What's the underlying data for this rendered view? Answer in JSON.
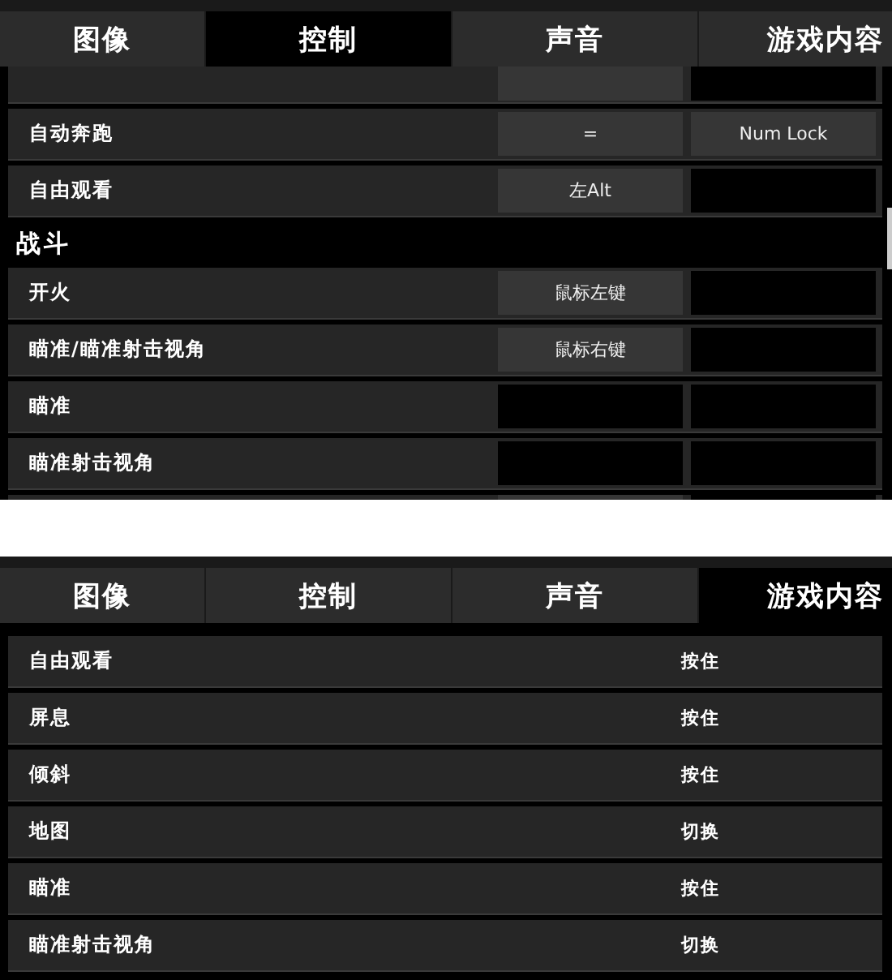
{
  "controls_screen": {
    "tabs": [
      {
        "label": "图像",
        "selected": false
      },
      {
        "label": "控制",
        "selected": true
      },
      {
        "label": "声音",
        "selected": false
      },
      {
        "label": "游戏内容",
        "selected": false
      }
    ],
    "bindings": [
      {
        "kind": "cut",
        "primary_bound": true,
        "secondary_bound": false
      },
      {
        "kind": "row",
        "action": "自动奔跑",
        "primary": "=",
        "secondary": "Num Lock"
      },
      {
        "kind": "row",
        "action": "自由观看",
        "primary": "左Alt"
      },
      {
        "kind": "heading",
        "title": "战斗"
      },
      {
        "kind": "row",
        "action": "开火",
        "primary": "鼠标左键"
      },
      {
        "kind": "row",
        "action": "瞄准/瞄准射击视角",
        "primary": "鼠标右键"
      },
      {
        "kind": "row",
        "action": "瞄准"
      },
      {
        "kind": "row",
        "action": "瞄准射击视角"
      },
      {
        "kind": "cut",
        "primary_bound": true,
        "secondary_bound": false
      }
    ]
  },
  "gameplay_screen": {
    "tabs": [
      {
        "label": "图像",
        "selected": false
      },
      {
        "label": "控制",
        "selected": false
      },
      {
        "label": "声音",
        "selected": false
      },
      {
        "label": "游戏内容",
        "selected": true
      }
    ],
    "options": [
      {
        "name": "自由观看",
        "mode": "按住"
      },
      {
        "name": "屏息",
        "mode": "按住"
      },
      {
        "name": "倾斜",
        "mode": "按住"
      },
      {
        "name": "地图",
        "mode": "切换"
      },
      {
        "name": "瞄准",
        "mode": "按住"
      },
      {
        "name": "瞄准射击视角",
        "mode": "切换"
      }
    ]
  }
}
